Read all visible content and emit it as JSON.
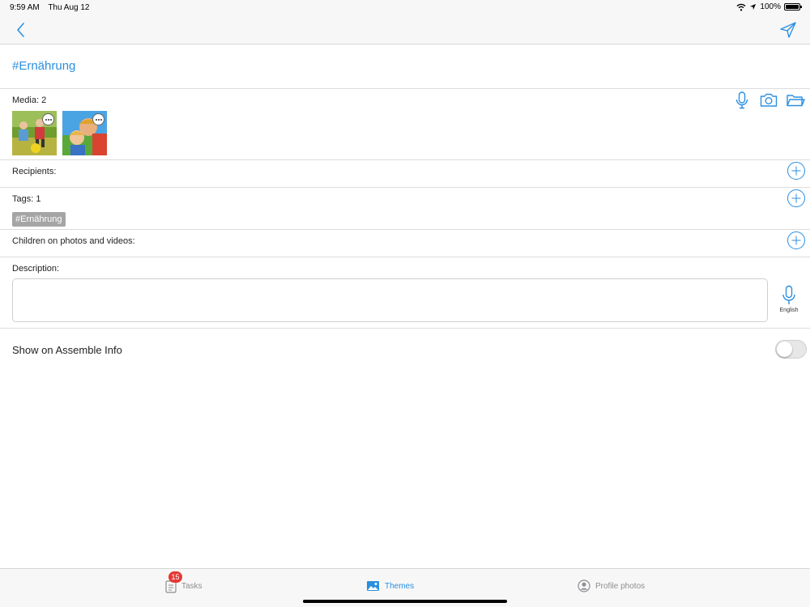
{
  "status_bar": {
    "time": "9:59 AM",
    "date": "Thu Aug 12",
    "battery_text": "100%",
    "battery_level": 1.0
  },
  "colors": {
    "accent": "#2b8fe0",
    "badge": "#e53935",
    "chip": "#a5a5a5"
  },
  "nav": {
    "back_icon": "chevron-left-icon",
    "send_icon": "paper-plane-icon"
  },
  "page_title": "#Ernährung",
  "media": {
    "label": "Media: 2",
    "actions": [
      "microphone-icon",
      "camera-icon",
      "folder-icon"
    ],
    "thumbnails": [
      {
        "name": "children-on-meadow-photo"
      },
      {
        "name": "family-smiling-photo"
      }
    ]
  },
  "recipients": {
    "label": "Recipients:"
  },
  "tags": {
    "label": "Tags: 1",
    "items": [
      "#Ernährung"
    ]
  },
  "children": {
    "label": "Children on photos and videos:"
  },
  "description": {
    "label": "Description:",
    "value": "",
    "dictation_language": "English"
  },
  "show_on_info": {
    "label": "Show on Assemble Info",
    "enabled": false
  },
  "tab_bar": {
    "tabs": [
      {
        "label": "Tasks",
        "badge": "15",
        "active": false
      },
      {
        "label": "Themes",
        "active": true
      },
      {
        "label": "Profile photos",
        "active": false
      }
    ]
  }
}
